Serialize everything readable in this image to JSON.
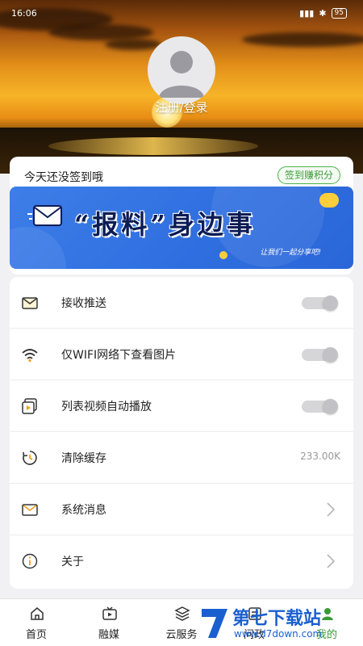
{
  "status_bar": {
    "time": "16:06",
    "battery": "95"
  },
  "profile": {
    "login_label": "注册/登录"
  },
  "checkin": {
    "text": "今天还没签到哦",
    "button": "签到赚积分"
  },
  "banner": {
    "title": "“报料”身边事",
    "subtitle": "让我们一起分享吧!"
  },
  "settings": [
    {
      "icon": "envelope-icon",
      "label": "接收推送",
      "control": "toggle",
      "on": false
    },
    {
      "icon": "wifi-icon",
      "label": "仅WIFI网络下查看图片",
      "control": "toggle",
      "on": false
    },
    {
      "icon": "video-icon",
      "label": "列表视频自动播放",
      "control": "toggle",
      "on": false
    },
    {
      "icon": "clock-icon",
      "label": "清除缓存",
      "control": "value",
      "value": "233.00K"
    },
    {
      "icon": "mail-icon",
      "label": "系统消息",
      "control": "chevron"
    },
    {
      "icon": "info-icon",
      "label": "关于",
      "control": "chevron"
    }
  ],
  "tabbar": [
    {
      "icon": "home-icon",
      "label": "首页",
      "active": false
    },
    {
      "icon": "media-icon",
      "label": "融媒",
      "active": false
    },
    {
      "icon": "cloud-service-icon",
      "label": "云服务",
      "active": false
    },
    {
      "icon": "affairs-icon",
      "label": "问政",
      "active": false
    },
    {
      "icon": "profile-icon",
      "label": "我的",
      "active": true
    }
  ],
  "watermark": {
    "title": "第七下载站",
    "url": "www.d7down.com"
  },
  "colors": {
    "accent_green": "#3a9a38",
    "banner_blue": "#2f6fe0"
  }
}
